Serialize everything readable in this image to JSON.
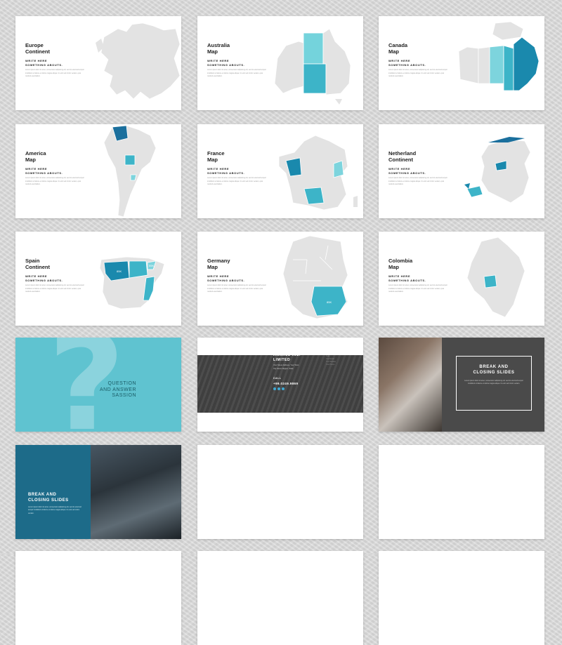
{
  "colors": {
    "accent_teal": "#4cb8cc",
    "accent_dark_blue": "#1a7fa5",
    "map_gray": "#e3e3e3",
    "qa_bg": "#5fc3d0",
    "dark_bg": "#4a4a4a",
    "blue_panel": "#1d6b89"
  },
  "map_slides": [
    {
      "title": "Europe\nContinent",
      "subtitle": "WRITE HERE\nSOMETHING ABOUTS.",
      "body": "Lorem ipsum dolor sit amet, consectetur adipiscing elit, sed do eiusmod tempor incididunt ut labore et dolore magna aliqua. Ut enim ad minim veniam, quis nostrud exercitation.",
      "highlighted_regions": []
    },
    {
      "title": "Australia\nMap",
      "subtitle": "WRITE HERE\nSOMETHING ABOUTS.",
      "body": "Lorem ipsum dolor sit amet, consectetur adipiscing elit, sed do eiusmod tempor incididunt ut labore et dolore magna aliqua. Ut enim ad minim veniam, quis nostrud exercitation.",
      "highlighted_regions": [
        "Northern Territory",
        "South Australia"
      ]
    },
    {
      "title": "Canada\nMap",
      "subtitle": "WRITE HERE\nSOMETHING ABOUTS.",
      "body": "Lorem ipsum dolor sit amet, consectetur adipiscing elit, sed do eiusmod tempor incididunt ut labore et dolore magna aliqua. Ut enim ad minim veniam, quis nostrud exercitation.",
      "highlighted_regions": [
        "Manitoba",
        "Quebec"
      ]
    },
    {
      "title": "America\nMap",
      "subtitle": "WRITE HERE\nSOMETHING ABOUTS.",
      "body": "Lorem ipsum dolor sit amet, consectetur adipiscing elit, sed do eiusmod tempor incididunt ut labore et dolore magna aliqua. Ut enim ad minim veniam, quis nostrud exercitation.",
      "highlighted_regions": [
        "Colombia",
        "Bolivia"
      ]
    },
    {
      "title": "France\nMap",
      "subtitle": "WRITE HERE\nSOMETHING ABOUTS.",
      "body": "Lorem ipsum dolor sit amet, consectetur adipiscing elit, sed do eiusmod tempor incididunt ut labore et dolore magna aliqua. Ut enim ad minim veniam, quis nostrud exercitation.",
      "highlighted_regions": [
        "Pays de la Loire",
        "Occitanie",
        "Rhone-Alpes"
      ]
    },
    {
      "title": "Netherland\nContinent",
      "subtitle": "WRITE HERE\nSOMETHING ABOUTS.",
      "body": "Lorem ipsum dolor sit amet, consectetur adipiscing elit, sed do eiusmod tempor incididunt ut labore et dolore magna aliqua. Ut enim ad minim veniam, quis nostrud exercitation.",
      "highlighted_regions": [
        "Friesland",
        "Flevoland",
        "Zeeland"
      ]
    },
    {
      "title": "Spain\nContinent",
      "subtitle": "WRITE HERE\nSOMETHING ABOUTS.",
      "body": "Lorem ipsum dolor sit amet, consectetur adipiscing elit, sed do eiusmod tempor incididunt ut labore et dolore magna aliqua. Ut enim ad minim veniam, quis nostrud exercitation.",
      "highlighted_regions": [
        "Castilla y Leon",
        "Aragon",
        "Valencia"
      ],
      "map_labels": [
        "85K",
        "55K"
      ]
    },
    {
      "title": "Germany\nMap",
      "subtitle": "WRITE HERE\nSOMETHING ABOUTS.",
      "body": "Lorem ipsum dolor sit amet, consectetur adipiscing elit, sed do eiusmod tempor incididunt ut labore et dolore magna aliqua. Ut enim ad minim veniam, quis nostrud exercitation.",
      "highlighted_regions": [
        "Bavaria"
      ],
      "map_labels": [
        "85K"
      ]
    },
    {
      "title": "Colombia\nMap",
      "subtitle": "WRITE HERE\nSOMETHING ABOUTS.",
      "body": "Lorem ipsum dolor sit amet, consectetur adipiscing elit, sed do eiusmod tempor incididunt ut labore et dolore magna aliqua. Ut enim ad minim veniam, quis nostrud exercitation.",
      "highlighted_regions": [
        "Tolima"
      ]
    }
  ],
  "qa_slide": {
    "mark": "?",
    "text": "QUESTION\nAND ANSWER\nSASSION"
  },
  "contact_slide": {
    "company": "ANNAUL INC.\nLIMITED",
    "address": "Your Street Address, Your Town\nCity Name Region, State",
    "call_label": "CALL",
    "phone": "+99.0249.9869",
    "social_icons": [
      "facebook-icon",
      "twitter-icon",
      "email-icon"
    ],
    "side_notes": "Year\nYour Email\nYour Website\nYour Phone"
  },
  "closing_slide": {
    "title": "BREAK AND\nCLOSING SLIDES",
    "body": "Lorem ipsum dolor sit amet, consectetur adipiscing elit, sed do eiusmod tempor incididunt ut labore et dolore magna aliqua. Ut enim ad minim veniam."
  },
  "closing_slide_2": {
    "title": "BREAK AND\nCLOSING SLIDES",
    "body": "Lorem ipsum dolor sit amet, consectetur adipiscing elit, sed do eiusmod tempor incididunt ut labore et dolore magna aliqua. Ut enim ad minim veniam."
  }
}
